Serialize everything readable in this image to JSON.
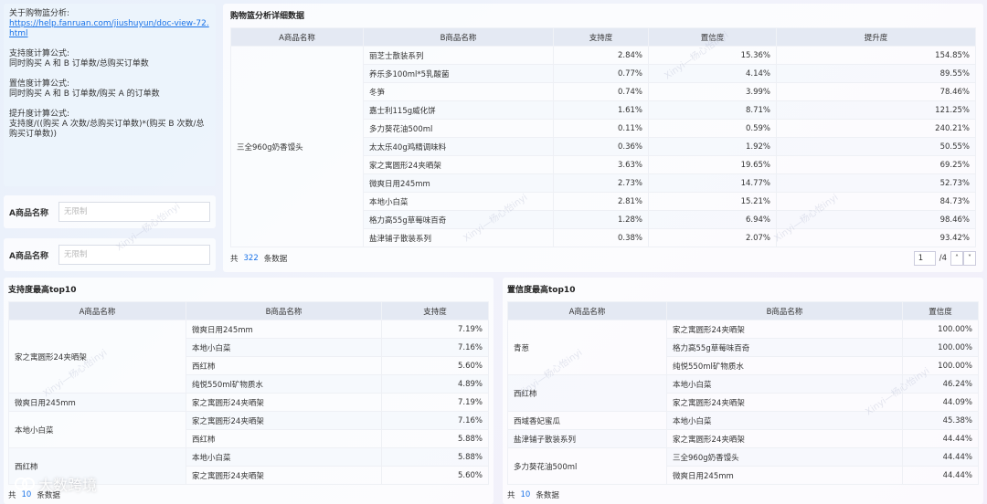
{
  "info": {
    "about_label": "关于购物篮分析:",
    "link": "https://help.fanruan.com/jiushuyun/doc-view-72.html",
    "support_title": "支持度计算公式:",
    "support_formula": "同时购买 A 和 B 订单数/总购买订单数",
    "confidence_title": "置信度计算公式:",
    "confidence_formula": "同时购买 A 和 B 订单数/购买 A 的订单数",
    "lift_title": "提升度计算公式:",
    "lift_formula": "支持度/((购买 A 次数/总购买订单数)*(购买 B 次数/总购买订单数))"
  },
  "filters": [
    {
      "label": "A商品名称",
      "placeholder": "无限制"
    },
    {
      "label": "A商品名称",
      "placeholder": "无限制"
    }
  ],
  "detail": {
    "title": "购物篮分析详细数据",
    "headers": [
      "A商品名称",
      "B商品名称",
      "支持度",
      "置信度",
      "提升度"
    ],
    "a_item": "三全960g奶香馒头",
    "rows": [
      [
        "丽芝士散装系列",
        "2.84%",
        "15.36%",
        "154.85%"
      ],
      [
        "养乐多100ml*5乳酸菌",
        "0.77%",
        "4.14%",
        "89.55%"
      ],
      [
        "冬笋",
        "0.74%",
        "3.99%",
        "78.46%"
      ],
      [
        "嘉士利115g威化饼",
        "1.61%",
        "8.71%",
        "121.25%"
      ],
      [
        "多力葵花油500ml",
        "0.11%",
        "0.59%",
        "240.21%"
      ],
      [
        "太太乐40g鸡精调味料",
        "0.36%",
        "1.92%",
        "50.55%"
      ],
      [
        "家之寓圆形24夹晒架",
        "3.63%",
        "19.65%",
        "69.25%"
      ],
      [
        "微爽日用245mm",
        "2.73%",
        "14.77%",
        "52.73%"
      ],
      [
        "本地小白菜",
        "2.81%",
        "15.21%",
        "84.73%"
      ],
      [
        "格力高55g草莓味百奇",
        "1.28%",
        "6.94%",
        "98.46%"
      ],
      [
        "盐津铺子散装系列",
        "0.38%",
        "2.07%",
        "93.42%"
      ]
    ],
    "footer_prefix": "共",
    "count": "322",
    "footer_suffix": "条数据",
    "page": "1",
    "total_pages": "/4"
  },
  "support_panel": {
    "title": "支持度最高top10",
    "headers": [
      "A商品名称",
      "B商品名称",
      "支持度"
    ],
    "groups": [
      {
        "a": "家之寓圆形24夹晒架",
        "rows": [
          [
            "微爽日用245mm",
            "7.19%"
          ],
          [
            "本地小白菜",
            "7.16%"
          ],
          [
            "西红柿",
            "5.60%"
          ],
          [
            "纯悦550ml矿物质水",
            "4.89%"
          ]
        ]
      },
      {
        "a": "微爽日用245mm",
        "rows": [
          [
            "家之寓圆形24夹晒架",
            "7.19%"
          ]
        ]
      },
      {
        "a": "本地小白菜",
        "rows": [
          [
            "家之寓圆形24夹晒架",
            "7.16%"
          ],
          [
            "西红柿",
            "5.88%"
          ]
        ]
      },
      {
        "a": "西红柿",
        "rows": [
          [
            "本地小白菜",
            "5.88%"
          ],
          [
            "家之寓圆形24夹晒架",
            "5.60%"
          ]
        ]
      }
    ],
    "footer_prefix": "共",
    "count": "10",
    "footer_suffix": "条数据"
  },
  "confidence_panel": {
    "title": "置信度最高top10",
    "headers": [
      "A商品名称",
      "B商品名称",
      "置信度"
    ],
    "groups": [
      {
        "a": "青葱",
        "rows": [
          [
            "家之寓圆形24夹晒架",
            "100.00%"
          ],
          [
            "格力高55g草莓味百奇",
            "100.00%"
          ],
          [
            "纯悦550ml矿物质水",
            "100.00%"
          ]
        ]
      },
      {
        "a": "西红柿",
        "rows": [
          [
            "本地小白菜",
            "46.24%"
          ],
          [
            "家之寓圆形24夹晒架",
            "44.09%"
          ]
        ]
      },
      {
        "a": "西域香妃蜜瓜",
        "rows": [
          [
            "本地小白菜",
            "45.38%"
          ]
        ]
      },
      {
        "a": "盐津铺子散装系列",
        "rows": [
          [
            "家之寓圆形24夹晒架",
            "44.44%"
          ]
        ]
      },
      {
        "a": "多力葵花油500ml",
        "rows": [
          [
            "三全960g奶香馒头",
            "44.44%"
          ],
          [
            "微爽日用245mm",
            "44.44%"
          ]
        ]
      }
    ],
    "footer_prefix": "共",
    "count": "10",
    "footer_suffix": "条数据"
  },
  "watermark_text": "Xinyi—杨心怡inyi",
  "logo_text": "大数跨境"
}
